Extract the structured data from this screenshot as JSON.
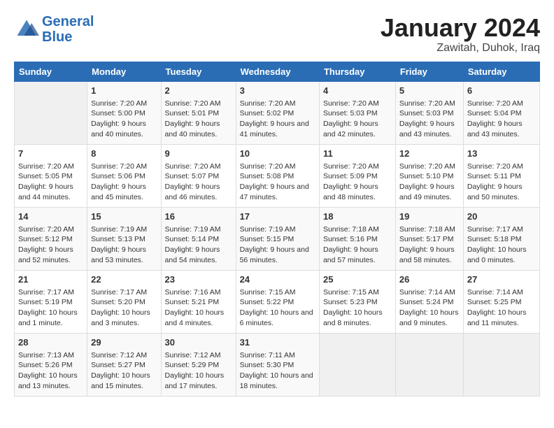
{
  "header": {
    "logo_line1": "General",
    "logo_line2": "Blue",
    "month": "January 2024",
    "location": "Zawitah, Duhok, Iraq"
  },
  "days_of_week": [
    "Sunday",
    "Monday",
    "Tuesday",
    "Wednesday",
    "Thursday",
    "Friday",
    "Saturday"
  ],
  "weeks": [
    [
      {
        "day": "",
        "empty": true
      },
      {
        "day": "1",
        "sunrise": "7:20 AM",
        "sunset": "5:00 PM",
        "daylight": "9 hours and 40 minutes."
      },
      {
        "day": "2",
        "sunrise": "7:20 AM",
        "sunset": "5:01 PM",
        "daylight": "9 hours and 40 minutes."
      },
      {
        "day": "3",
        "sunrise": "7:20 AM",
        "sunset": "5:02 PM",
        "daylight": "9 hours and 41 minutes."
      },
      {
        "day": "4",
        "sunrise": "7:20 AM",
        "sunset": "5:03 PM",
        "daylight": "9 hours and 42 minutes."
      },
      {
        "day": "5",
        "sunrise": "7:20 AM",
        "sunset": "5:03 PM",
        "daylight": "9 hours and 43 minutes."
      },
      {
        "day": "6",
        "sunrise": "7:20 AM",
        "sunset": "5:04 PM",
        "daylight": "9 hours and 43 minutes."
      }
    ],
    [
      {
        "day": "7",
        "sunrise": "7:20 AM",
        "sunset": "5:05 PM",
        "daylight": "9 hours and 44 minutes."
      },
      {
        "day": "8",
        "sunrise": "7:20 AM",
        "sunset": "5:06 PM",
        "daylight": "9 hours and 45 minutes."
      },
      {
        "day": "9",
        "sunrise": "7:20 AM",
        "sunset": "5:07 PM",
        "daylight": "9 hours and 46 minutes."
      },
      {
        "day": "10",
        "sunrise": "7:20 AM",
        "sunset": "5:08 PM",
        "daylight": "9 hours and 47 minutes."
      },
      {
        "day": "11",
        "sunrise": "7:20 AM",
        "sunset": "5:09 PM",
        "daylight": "9 hours and 48 minutes."
      },
      {
        "day": "12",
        "sunrise": "7:20 AM",
        "sunset": "5:10 PM",
        "daylight": "9 hours and 49 minutes."
      },
      {
        "day": "13",
        "sunrise": "7:20 AM",
        "sunset": "5:11 PM",
        "daylight": "9 hours and 50 minutes."
      }
    ],
    [
      {
        "day": "14",
        "sunrise": "7:20 AM",
        "sunset": "5:12 PM",
        "daylight": "9 hours and 52 minutes."
      },
      {
        "day": "15",
        "sunrise": "7:19 AM",
        "sunset": "5:13 PM",
        "daylight": "9 hours and 53 minutes."
      },
      {
        "day": "16",
        "sunrise": "7:19 AM",
        "sunset": "5:14 PM",
        "daylight": "9 hours and 54 minutes."
      },
      {
        "day": "17",
        "sunrise": "7:19 AM",
        "sunset": "5:15 PM",
        "daylight": "9 hours and 56 minutes."
      },
      {
        "day": "18",
        "sunrise": "7:18 AM",
        "sunset": "5:16 PM",
        "daylight": "9 hours and 57 minutes."
      },
      {
        "day": "19",
        "sunrise": "7:18 AM",
        "sunset": "5:17 PM",
        "daylight": "9 hours and 58 minutes."
      },
      {
        "day": "20",
        "sunrise": "7:17 AM",
        "sunset": "5:18 PM",
        "daylight": "10 hours and 0 minutes."
      }
    ],
    [
      {
        "day": "21",
        "sunrise": "7:17 AM",
        "sunset": "5:19 PM",
        "daylight": "10 hours and 1 minute."
      },
      {
        "day": "22",
        "sunrise": "7:17 AM",
        "sunset": "5:20 PM",
        "daylight": "10 hours and 3 minutes."
      },
      {
        "day": "23",
        "sunrise": "7:16 AM",
        "sunset": "5:21 PM",
        "daylight": "10 hours and 4 minutes."
      },
      {
        "day": "24",
        "sunrise": "7:15 AM",
        "sunset": "5:22 PM",
        "daylight": "10 hours and 6 minutes."
      },
      {
        "day": "25",
        "sunrise": "7:15 AM",
        "sunset": "5:23 PM",
        "daylight": "10 hours and 8 minutes."
      },
      {
        "day": "26",
        "sunrise": "7:14 AM",
        "sunset": "5:24 PM",
        "daylight": "10 hours and 9 minutes."
      },
      {
        "day": "27",
        "sunrise": "7:14 AM",
        "sunset": "5:25 PM",
        "daylight": "10 hours and 11 minutes."
      }
    ],
    [
      {
        "day": "28",
        "sunrise": "7:13 AM",
        "sunset": "5:26 PM",
        "daylight": "10 hours and 13 minutes."
      },
      {
        "day": "29",
        "sunrise": "7:12 AM",
        "sunset": "5:27 PM",
        "daylight": "10 hours and 15 minutes."
      },
      {
        "day": "30",
        "sunrise": "7:12 AM",
        "sunset": "5:29 PM",
        "daylight": "10 hours and 17 minutes."
      },
      {
        "day": "31",
        "sunrise": "7:11 AM",
        "sunset": "5:30 PM",
        "daylight": "10 hours and 18 minutes."
      },
      {
        "day": "",
        "empty": true
      },
      {
        "day": "",
        "empty": true
      },
      {
        "day": "",
        "empty": true
      }
    ]
  ]
}
